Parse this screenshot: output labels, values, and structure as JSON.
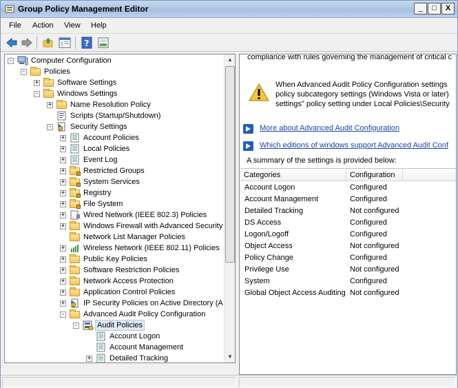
{
  "window": {
    "title": "Group Policy Management Editor"
  },
  "window_buttons": {
    "minimize": "_",
    "maximize": "□",
    "close": "X"
  },
  "menu": [
    "File",
    "Action",
    "View",
    "Help"
  ],
  "toolbar": {
    "icons": [
      "back-arrow-icon",
      "forward-arrow-icon",
      "up-folder-icon",
      "show-hide-tree-icon",
      "help-icon",
      "properties-icon"
    ]
  },
  "tree": [
    {
      "label": "Computer Configuration",
      "expander": "−",
      "icon": "computer-icon"
    },
    {
      "label": "Policies",
      "expander": "−",
      "icon": "folder-icon"
    },
    {
      "label": "Software Settings",
      "expander": "+",
      "icon": "folder-icon"
    },
    {
      "label": "Windows Settings",
      "expander": "−",
      "icon": "folder-icon"
    },
    {
      "label": "Name Resolution Policy",
      "expander": "+",
      "icon": "folder-icon"
    },
    {
      "label": "Scripts (Startup/Shutdown)",
      "expander": "",
      "icon": "scripts-icon"
    },
    {
      "label": "Security Settings",
      "expander": "−",
      "icon": "security-settings-icon"
    },
    {
      "label": "Account Policies",
      "expander": "+",
      "icon": "policy-doc-icon"
    },
    {
      "label": "Local Policies",
      "expander": "+",
      "icon": "policy-doc-icon"
    },
    {
      "label": "Event Log",
      "expander": "+",
      "icon": "policy-doc-icon"
    },
    {
      "label": "Restricted Groups",
      "expander": "+",
      "icon": "locked-folder-icon"
    },
    {
      "label": "System Services",
      "expander": "+",
      "icon": "locked-folder-icon"
    },
    {
      "label": "Registry",
      "expander": "+",
      "icon": "locked-folder-icon"
    },
    {
      "label": "File System",
      "expander": "+",
      "icon": "locked-folder-icon"
    },
    {
      "label": "Wired Network (IEEE 802.3) Policies",
      "expander": "+",
      "icon": "wired-network-icon"
    },
    {
      "label": "Windows Firewall with Advanced Security",
      "expander": "+",
      "icon": "folder-icon"
    },
    {
      "label": "Network List Manager Policies",
      "expander": "",
      "icon": "folder-icon"
    },
    {
      "label": "Wireless Network (IEEE 802.11) Policies",
      "expander": "+",
      "icon": "wireless-network-icon"
    },
    {
      "label": "Public Key Policies",
      "expander": "+",
      "icon": "folder-icon"
    },
    {
      "label": "Software Restriction Policies",
      "expander": "+",
      "icon": "folder-icon"
    },
    {
      "label": "Network Access Protection",
      "expander": "+",
      "icon": "folder-icon"
    },
    {
      "label": "Application Control Policies",
      "expander": "+",
      "icon": "folder-icon"
    },
    {
      "label": "IP Security Policies on Active Directory (A",
      "expander": "+",
      "icon": "ip-security-icon"
    },
    {
      "label": "Advanced Audit Policy Configuration",
      "expander": "−",
      "icon": "folder-icon"
    },
    {
      "label": "Audit Policies",
      "expander": "−",
      "icon": "audit-policies-icon",
      "selected": true
    },
    {
      "label": "Account Logon",
      "expander": "",
      "icon": "policy-doc-icon"
    },
    {
      "label": "Account Management",
      "expander": "",
      "icon": "policy-doc-icon"
    },
    {
      "label": "Detailed Tracking",
      "expander": "+",
      "icon": "policy-doc-icon"
    }
  ],
  "details": {
    "top_text": "compliance with rules governing the management of critical c",
    "warning_lines": [
      "When Advanced Audit Policy Configuration settings",
      "policy subcategory settings (Windows Vista or later)",
      "settings\" policy setting under Local Policies\\Security"
    ],
    "links": [
      "More about Advanced Audit Configuration",
      "Which editions of windows support Advanced Audit Conf"
    ],
    "summary": "A summary of the settings is provided below:",
    "columns": [
      "Categories",
      "Configuration"
    ],
    "rows": [
      [
        "Account Logon",
        "Configured"
      ],
      [
        "Account Management",
        "Configured"
      ],
      [
        "Detailed Tracking",
        "Not configured"
      ],
      [
        "DS Access",
        "Configured"
      ],
      [
        "Logon/Logoff",
        "Configured"
      ],
      [
        "Object Access",
        "Not configured"
      ],
      [
        "Policy Change",
        "Configured"
      ],
      [
        "Privilege Use",
        "Not configured"
      ],
      [
        "System",
        "Configured"
      ],
      [
        "Global Object Access Auditing",
        "Not configured"
      ]
    ]
  }
}
